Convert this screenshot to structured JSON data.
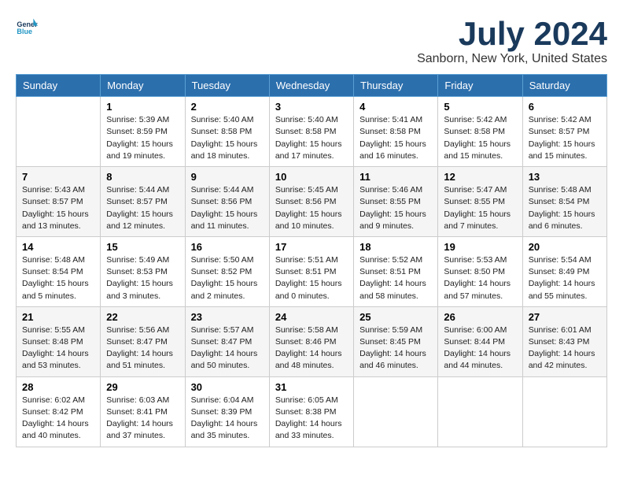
{
  "header": {
    "logo_line1": "General",
    "logo_line2": "Blue",
    "title": "July 2024",
    "subtitle": "Sanborn, New York, United States"
  },
  "calendar": {
    "days_of_week": [
      "Sunday",
      "Monday",
      "Tuesday",
      "Wednesday",
      "Thursday",
      "Friday",
      "Saturday"
    ],
    "weeks": [
      [
        {
          "day": "",
          "info": ""
        },
        {
          "day": "1",
          "info": "Sunrise: 5:39 AM\nSunset: 8:59 PM\nDaylight: 15 hours\nand 19 minutes."
        },
        {
          "day": "2",
          "info": "Sunrise: 5:40 AM\nSunset: 8:58 PM\nDaylight: 15 hours\nand 18 minutes."
        },
        {
          "day": "3",
          "info": "Sunrise: 5:40 AM\nSunset: 8:58 PM\nDaylight: 15 hours\nand 17 minutes."
        },
        {
          "day": "4",
          "info": "Sunrise: 5:41 AM\nSunset: 8:58 PM\nDaylight: 15 hours\nand 16 minutes."
        },
        {
          "day": "5",
          "info": "Sunrise: 5:42 AM\nSunset: 8:58 PM\nDaylight: 15 hours\nand 15 minutes."
        },
        {
          "day": "6",
          "info": "Sunrise: 5:42 AM\nSunset: 8:57 PM\nDaylight: 15 hours\nand 15 minutes."
        }
      ],
      [
        {
          "day": "7",
          "info": "Sunrise: 5:43 AM\nSunset: 8:57 PM\nDaylight: 15 hours\nand 13 minutes."
        },
        {
          "day": "8",
          "info": "Sunrise: 5:44 AM\nSunset: 8:57 PM\nDaylight: 15 hours\nand 12 minutes."
        },
        {
          "day": "9",
          "info": "Sunrise: 5:44 AM\nSunset: 8:56 PM\nDaylight: 15 hours\nand 11 minutes."
        },
        {
          "day": "10",
          "info": "Sunrise: 5:45 AM\nSunset: 8:56 PM\nDaylight: 15 hours\nand 10 minutes."
        },
        {
          "day": "11",
          "info": "Sunrise: 5:46 AM\nSunset: 8:55 PM\nDaylight: 15 hours\nand 9 minutes."
        },
        {
          "day": "12",
          "info": "Sunrise: 5:47 AM\nSunset: 8:55 PM\nDaylight: 15 hours\nand 7 minutes."
        },
        {
          "day": "13",
          "info": "Sunrise: 5:48 AM\nSunset: 8:54 PM\nDaylight: 15 hours\nand 6 minutes."
        }
      ],
      [
        {
          "day": "14",
          "info": "Sunrise: 5:48 AM\nSunset: 8:54 PM\nDaylight: 15 hours\nand 5 minutes."
        },
        {
          "day": "15",
          "info": "Sunrise: 5:49 AM\nSunset: 8:53 PM\nDaylight: 15 hours\nand 3 minutes."
        },
        {
          "day": "16",
          "info": "Sunrise: 5:50 AM\nSunset: 8:52 PM\nDaylight: 15 hours\nand 2 minutes."
        },
        {
          "day": "17",
          "info": "Sunrise: 5:51 AM\nSunset: 8:51 PM\nDaylight: 15 hours\nand 0 minutes."
        },
        {
          "day": "18",
          "info": "Sunrise: 5:52 AM\nSunset: 8:51 PM\nDaylight: 14 hours\nand 58 minutes."
        },
        {
          "day": "19",
          "info": "Sunrise: 5:53 AM\nSunset: 8:50 PM\nDaylight: 14 hours\nand 57 minutes."
        },
        {
          "day": "20",
          "info": "Sunrise: 5:54 AM\nSunset: 8:49 PM\nDaylight: 14 hours\nand 55 minutes."
        }
      ],
      [
        {
          "day": "21",
          "info": "Sunrise: 5:55 AM\nSunset: 8:48 PM\nDaylight: 14 hours\nand 53 minutes."
        },
        {
          "day": "22",
          "info": "Sunrise: 5:56 AM\nSunset: 8:47 PM\nDaylight: 14 hours\nand 51 minutes."
        },
        {
          "day": "23",
          "info": "Sunrise: 5:57 AM\nSunset: 8:47 PM\nDaylight: 14 hours\nand 50 minutes."
        },
        {
          "day": "24",
          "info": "Sunrise: 5:58 AM\nSunset: 8:46 PM\nDaylight: 14 hours\nand 48 minutes."
        },
        {
          "day": "25",
          "info": "Sunrise: 5:59 AM\nSunset: 8:45 PM\nDaylight: 14 hours\nand 46 minutes."
        },
        {
          "day": "26",
          "info": "Sunrise: 6:00 AM\nSunset: 8:44 PM\nDaylight: 14 hours\nand 44 minutes."
        },
        {
          "day": "27",
          "info": "Sunrise: 6:01 AM\nSunset: 8:43 PM\nDaylight: 14 hours\nand 42 minutes."
        }
      ],
      [
        {
          "day": "28",
          "info": "Sunrise: 6:02 AM\nSunset: 8:42 PM\nDaylight: 14 hours\nand 40 minutes."
        },
        {
          "day": "29",
          "info": "Sunrise: 6:03 AM\nSunset: 8:41 PM\nDaylight: 14 hours\nand 37 minutes."
        },
        {
          "day": "30",
          "info": "Sunrise: 6:04 AM\nSunset: 8:39 PM\nDaylight: 14 hours\nand 35 minutes."
        },
        {
          "day": "31",
          "info": "Sunrise: 6:05 AM\nSunset: 8:38 PM\nDaylight: 14 hours\nand 33 minutes."
        },
        {
          "day": "",
          "info": ""
        },
        {
          "day": "",
          "info": ""
        },
        {
          "day": "",
          "info": ""
        }
      ]
    ]
  }
}
